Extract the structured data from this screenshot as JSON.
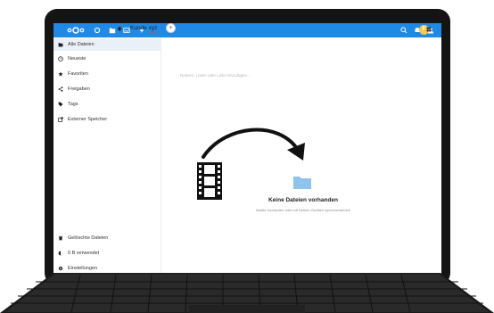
{
  "header": {
    "logo_icon": "nextcloud-logo",
    "nav_icons": [
      "dashboard-icon",
      "files-icon",
      "photos-icon",
      "activity-icon"
    ],
    "right_icons": [
      "search-icon",
      "notifications-icon",
      "contacts-icon"
    ],
    "avatar_letter": "F",
    "brand_color": "#1e8ae6"
  },
  "sidebar": {
    "items": [
      {
        "label": "Alle Dateien",
        "icon": "folder-icon",
        "active": true
      },
      {
        "label": "Neueste",
        "icon": "clock-icon"
      },
      {
        "label": "Favoriten",
        "icon": "star-icon"
      },
      {
        "label": "Freigaben",
        "icon": "share-icon"
      },
      {
        "label": "Tags",
        "icon": "tag-icon"
      },
      {
        "label": "Externer Speicher",
        "icon": "external-storage-icon"
      }
    ],
    "bottom": [
      {
        "label": "Gelöschte Dateien",
        "icon": "trash-icon"
      },
      {
        "label": "0 B verwendet",
        "icon": "quota-icon"
      },
      {
        "label": "Einstellungen",
        "icon": "settings-icon"
      }
    ]
  },
  "main": {
    "breadcrumb_prefix": "Kunde ",
    "breadcrumb_underlined": "xyz",
    "add_label": "+",
    "notes_placeholder": "Notizen, Listen oder Links hinzufügen…",
    "empty_title": "Keine Dateien vorhanden",
    "empty_subtitle": "Inhalte hochladen oder mit Deinen Geräten synchronisieren!"
  }
}
